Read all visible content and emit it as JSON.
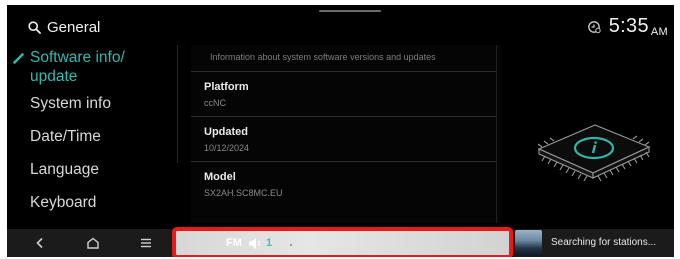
{
  "header": {
    "search_label": "General",
    "time": "5:35",
    "ampm": "AM"
  },
  "sidebar": {
    "items": [
      {
        "label": "Software info/",
        "label_line2": "update",
        "active": true
      },
      {
        "label": "System info"
      },
      {
        "label": "Date/Time"
      },
      {
        "label": "Language"
      },
      {
        "label": "Keyboard"
      }
    ]
  },
  "content": {
    "description": "Information about system software versions and updates",
    "rows": [
      {
        "label": "Platform",
        "value": "ccNC"
      },
      {
        "label": "Updated",
        "value": "10/12/2024"
      },
      {
        "label": "Model",
        "value": "SX2AH.SC8MC.EU"
      }
    ]
  },
  "navbar": {
    "icons": [
      "back-icon",
      "home-icon",
      "menu-icon"
    ],
    "radio": {
      "band": "FM",
      "volume_level": "1"
    },
    "station_status": "Searching for stations..."
  },
  "colors": {
    "accent": "#33b8b0",
    "highlight": "#e81b1b",
    "background": "#000000"
  }
}
